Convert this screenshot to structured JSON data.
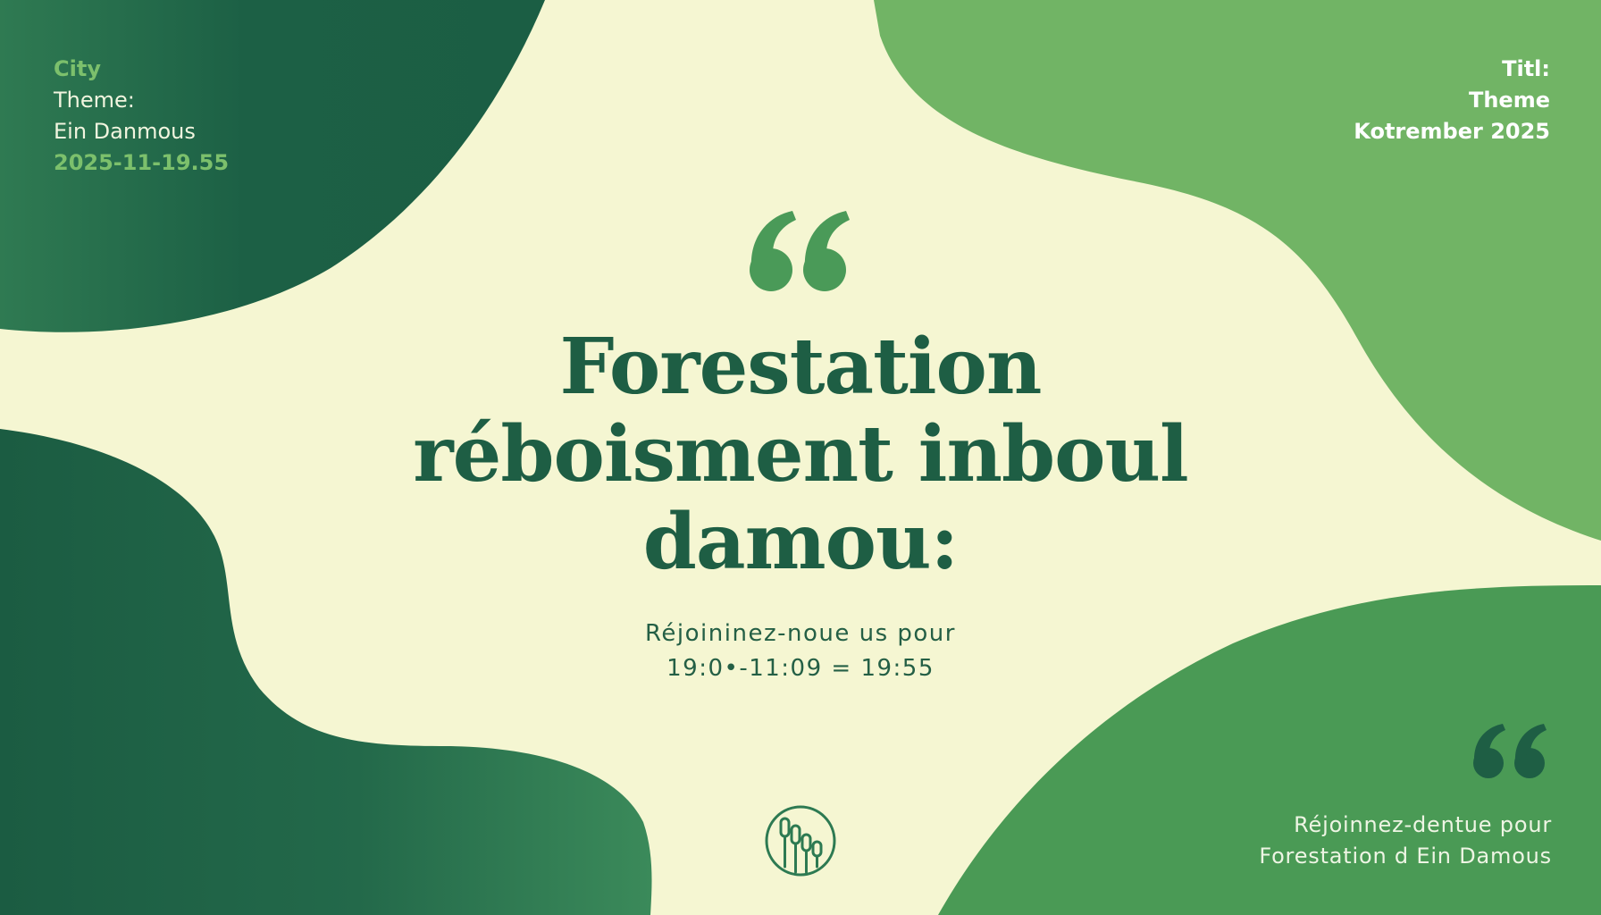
{
  "top_left": {
    "line1": "City",
    "line2": "Theme:",
    "line3": "Ein Danmous",
    "line4": "2025-11-19.55"
  },
  "top_right": {
    "line1": "Titl:",
    "line2": "Theme",
    "line3": "Kotrember 2025"
  },
  "headline": {
    "line1": "Forestation",
    "line2": "réboisment inboul",
    "line3": "damou:"
  },
  "subtitle": {
    "line1": "Réjoininez-noue us pour",
    "line2": "19:0•-11:09 = 19:55"
  },
  "bottom_right": {
    "line1": "Réjoinnez-dentue pour",
    "line2": "Forestation d Ein Damous"
  },
  "icons": {
    "main_quote": "open-quote-icon",
    "small_quote": "open-quote-icon",
    "logo": "reeds-logo-icon"
  },
  "colors": {
    "background": "#f5f6d2",
    "dark_green": "#1e5e44",
    "mid_green": "#4a9a55",
    "light_green": "#72b465",
    "accent_text": "#7cc06c"
  }
}
